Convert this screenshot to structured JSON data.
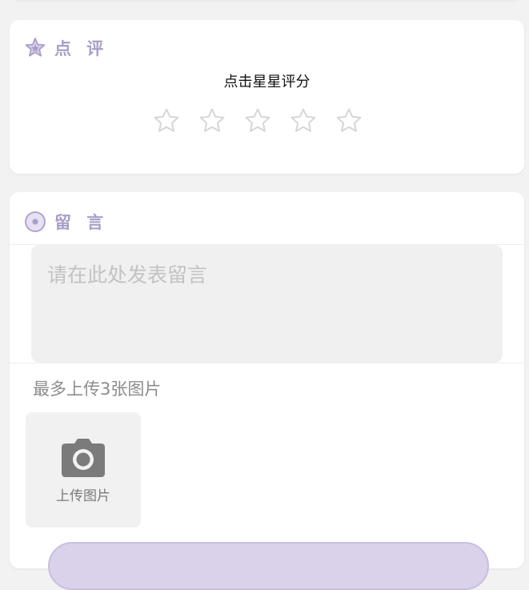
{
  "review": {
    "title": "点 评",
    "title_icon": "star-badge-icon",
    "hint": "点击星星评分",
    "star_icon": "star-outline-icon",
    "stars": [
      {
        "label": ""
      },
      {
        "label": ""
      },
      {
        "label": ""
      },
      {
        "label": ""
      },
      {
        "label": ""
      }
    ],
    "rating": 0,
    "max_rating": 5
  },
  "message": {
    "title": "留 言",
    "title_icon": "message-bubble-icon",
    "placeholder": "请在此处发表留言",
    "value": "",
    "upload_hint": "最多上传3张图片",
    "upload_button_label": "上传图片",
    "upload_icon": "camera-icon"
  },
  "colors": {
    "accent": "#a99ec7",
    "card_background": "#ffffff",
    "page_background": "#f2f2f2",
    "input_background": "#f0f0f0",
    "star_outline": "#d6d6d6",
    "button_background": "#d9d2ea"
  }
}
